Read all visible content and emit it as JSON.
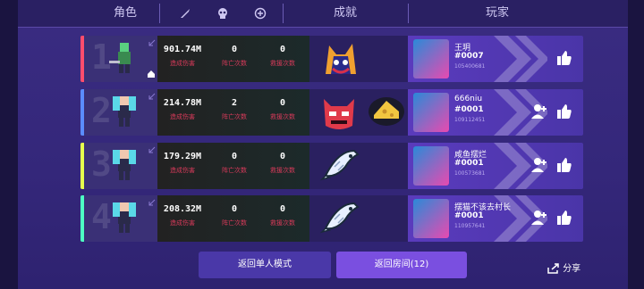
{
  "header": {
    "role_label": "角色",
    "achievement_label": "成就",
    "player_label": "玩家"
  },
  "rows": [
    {
      "rank": "1",
      "stripe_color": "#ff4d6d",
      "damage": "901.74M",
      "damage_label": "造成伤害",
      "deaths": "0",
      "deaths_label": "阵亡次数",
      "rescues": "0",
      "rescues_label": "救援次数",
      "achievements": [
        "wolf-badge"
      ],
      "player_name": "王玥",
      "player_id": "#0007",
      "player_uid": "105400681",
      "show_add_friend": false
    },
    {
      "rank": "2",
      "stripe_color": "#5b8cff",
      "damage": "214.78M",
      "damage_label": "造成伤害",
      "deaths": "2",
      "deaths_label": "阵亡次数",
      "rescues": "0",
      "rescues_label": "救援次数",
      "achievements": [
        "devil-badge",
        "cheese-badge"
      ],
      "player_name": "666niu",
      "player_id": "#0001",
      "player_uid": "109112451",
      "show_add_friend": true
    },
    {
      "rank": "3",
      "stripe_color": "#e6ff4d",
      "damage": "179.29M",
      "damage_label": "造成伤害",
      "deaths": "0",
      "deaths_label": "阵亡次数",
      "rescues": "0",
      "rescues_label": "救援次数",
      "achievements": [
        "fish-badge"
      ],
      "player_name": "咸鱼摆烂",
      "player_id": "#0001",
      "player_uid": "100573681",
      "show_add_friend": true
    },
    {
      "rank": "4",
      "stripe_color": "#4dffc3",
      "damage": "208.32M",
      "damage_label": "造成伤害",
      "deaths": "0",
      "deaths_label": "阵亡次数",
      "rescues": "0",
      "rescues_label": "救援次数",
      "achievements": [
        "fish-badge"
      ],
      "player_name": "摆猫不该去村长",
      "player_id": "#0001",
      "player_uid": "110957641",
      "show_add_friend": true
    }
  ],
  "buttons": {
    "single_mode": "返回单人模式",
    "room": "返回房间(12)",
    "share": "分享"
  }
}
